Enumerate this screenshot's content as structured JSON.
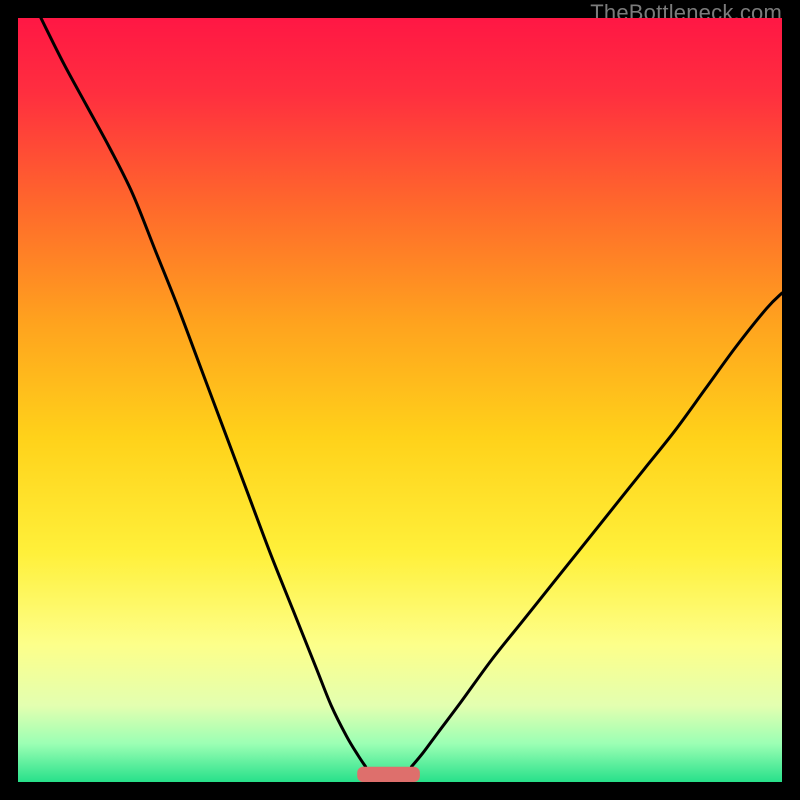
{
  "watermark": "TheBottleneck.com",
  "chart_data": {
    "type": "line",
    "title": "",
    "xlabel": "",
    "ylabel": "",
    "xlim": [
      0,
      100
    ],
    "ylim": [
      0,
      100
    ],
    "background_gradient_stops": [
      {
        "offset": 0.0,
        "color": "#ff1744"
      },
      {
        "offset": 0.1,
        "color": "#ff2f3f"
      },
      {
        "offset": 0.25,
        "color": "#ff6a2b"
      },
      {
        "offset": 0.4,
        "color": "#ffa31e"
      },
      {
        "offset": 0.55,
        "color": "#ffd21a"
      },
      {
        "offset": 0.7,
        "color": "#fff03a"
      },
      {
        "offset": 0.82,
        "color": "#fdff8a"
      },
      {
        "offset": 0.9,
        "color": "#e3ffb0"
      },
      {
        "offset": 0.95,
        "color": "#9bffb4"
      },
      {
        "offset": 1.0,
        "color": "#27e08a"
      }
    ],
    "marker": {
      "x": 48.5,
      "y": 1.0,
      "width": 8.2,
      "height": 2.0,
      "color": "#de6f6c"
    },
    "series": [
      {
        "name": "left-arm",
        "x": [
          3.0,
          6.0,
          9.0,
          12.0,
          15.0,
          18.0,
          21.0,
          24.0,
          27.0,
          30.0,
          33.0,
          36.0,
          39.0,
          41.0,
          43.0,
          44.5,
          45.5
        ],
        "values": [
          100.0,
          94.0,
          88.5,
          83.0,
          77.0,
          69.5,
          62.0,
          54.0,
          46.0,
          38.0,
          30.0,
          22.5,
          15.0,
          10.0,
          6.0,
          3.5,
          2.0
        ]
      },
      {
        "name": "right-arm",
        "x": [
          51.5,
          53.0,
          55.0,
          58.0,
          62.0,
          66.0,
          70.0,
          74.0,
          78.0,
          82.0,
          86.0,
          90.0,
          94.0,
          98.0,
          100.0
        ],
        "values": [
          2.0,
          3.8,
          6.5,
          10.5,
          16.0,
          21.0,
          26.0,
          31.0,
          36.0,
          41.0,
          46.0,
          51.5,
          57.0,
          62.0,
          64.0
        ]
      }
    ]
  }
}
